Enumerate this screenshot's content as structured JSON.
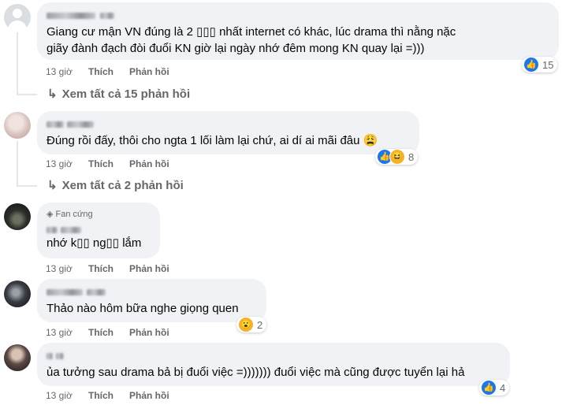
{
  "comments": [
    {
      "author": "",
      "text_lines": [
        "Giang cư mận VN đúng là 2 ▯▯▯ nhất internet có khác, lúc drama thì nằng nặc",
        "giãy đành đạch đòi đuổi KN giờ lại ngày nhớ đêm mong KN quay lại =)))"
      ],
      "time": "13 giờ",
      "like": "Thích",
      "reply": "Phản hồi",
      "reaction_count": "15",
      "reactions": [
        "like-icon"
      ],
      "view_replies": "Xem tất cả 15 phản hồi"
    },
    {
      "author": "",
      "text_lines": [
        "Đúng rồi đấy, thôi cho ngta 1 lối làm lại chứ, ai dí ai mãi đâu 😩"
      ],
      "time": "13 giờ",
      "like": "Thích",
      "reply": "Phản hồi",
      "reaction_count": "8",
      "reactions": [
        "like-icon",
        "haha-icon"
      ],
      "view_replies": "Xem tất cả 2 phản hồi"
    },
    {
      "badge": "Fan cứng",
      "author": "",
      "text_lines": [
        "nhớ k▯▯ ng▯▯ lắm"
      ],
      "time": "13 giờ",
      "like": "Thích",
      "reply": "Phản hồi"
    },
    {
      "author": "",
      "text_lines": [
        "Thảo nào hôm bữa nghe giọng quen"
      ],
      "time": "13 giờ",
      "like": "Thích",
      "reply": "Phản hồi",
      "reaction_count": "2",
      "reactions": [
        "wow-icon"
      ]
    },
    {
      "author": "",
      "text_lines": [
        "ủa tưởng sau drama bả bị đuổi việc =))))))) đuổi việc mà cũng được tuyển lại hả"
      ],
      "time": "13 giờ",
      "like": "Thích",
      "reply": "Phản hồi",
      "reaction_count": "4",
      "reactions": [
        "like-icon"
      ]
    }
  ],
  "colors": {
    "bubble": "#f0f2f5",
    "meta": "#65676b",
    "like_blue": "#1877f2",
    "emoji_yellow": "#f7b125"
  }
}
